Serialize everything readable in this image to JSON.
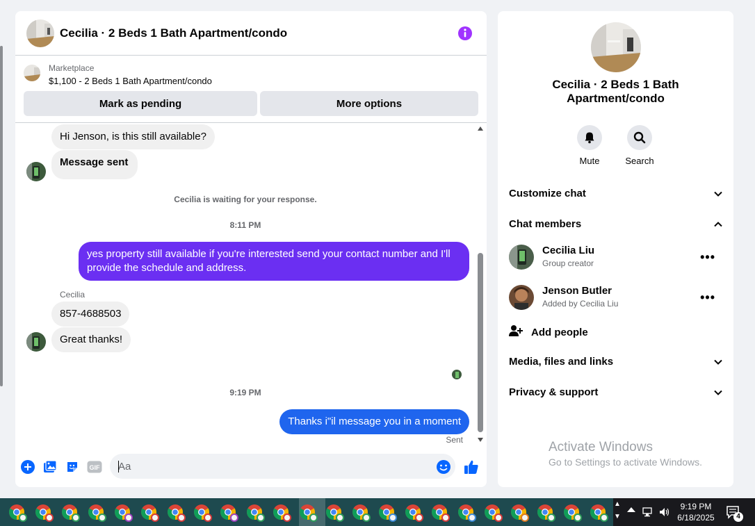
{
  "chat": {
    "title": "Cecilia · 2 Beds 1 Bath Apartment/condo",
    "listing": {
      "label": "Marketplace",
      "price_title": "$1,100 - 2 Beds 1 Bath Apartment/condo"
    },
    "buttons": {
      "pending": "Mark as pending",
      "more": "More options"
    },
    "messages": {
      "m1": "Hi Jenson, is this still available?",
      "m2": "Message sent",
      "waiting": "Cecilia is waiting for your response.",
      "time1": "8:11 PM",
      "m3": "yes property still available if you're interested send your contact number and I'll provide the schedule and address.",
      "sender": "Cecilia",
      "m4": "857-4688503",
      "m5": "Great thanks!",
      "time2": "9:19 PM",
      "m6": "Thanks i\"il message you in a moment",
      "sent": "Sent"
    },
    "composer": {
      "placeholder": "Aa"
    },
    "colors": {
      "accent": "#a033ff",
      "bubble_purple": "#6b2ff2",
      "bubble_blue": "#1f65ee",
      "icon_blue": "#0866ff"
    }
  },
  "info_panel": {
    "title": "Cecilia · 2 Beds 1 Bath Apartment/condo",
    "actions": {
      "mute": "Mute",
      "search": "Search"
    },
    "sections": {
      "customize": "Customize chat",
      "members": "Chat members",
      "media": "Media, files and links",
      "privacy": "Privacy & support"
    },
    "members": [
      {
        "name": "Cecilia Liu",
        "role": "Group creator"
      },
      {
        "name": "Jenson Butler",
        "role": "Added by Cecilia Liu"
      }
    ],
    "add_people": "Add people"
  },
  "watermark": {
    "title": "Activate Windows",
    "subtitle": "Go to Settings to activate Windows."
  },
  "taskbar": {
    "time": "9:19 PM",
    "date": "6/18/2025",
    "notification_count": "4"
  }
}
